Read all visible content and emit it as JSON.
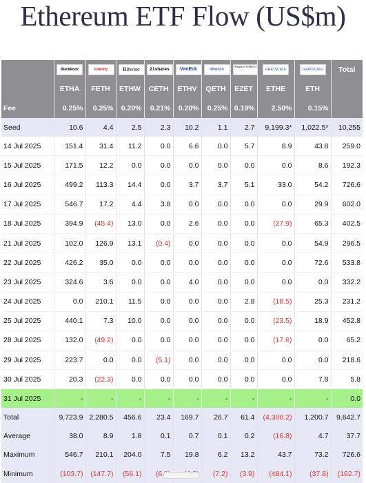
{
  "title": "Ethereum ETF Flow (US$m)",
  "header": {
    "total_label": "Total",
    "fee_label": "Fee",
    "funds": [
      {
        "logo": "BlackRock",
        "ticker": "ETHA",
        "fee": "0.25%"
      },
      {
        "logo": "Fidelity",
        "ticker": "FETH",
        "fee": "0.25%"
      },
      {
        "logo": "Bitwise",
        "ticker": "ETHW",
        "fee": "0.20%"
      },
      {
        "logo": "21shares",
        "ticker": "CETH",
        "fee": "0.21%"
      },
      {
        "logo": "VanEck",
        "ticker": "ETHV",
        "fee": "0.20%"
      },
      {
        "logo": "Invesco",
        "ticker": "QETH",
        "fee": "0.25%"
      },
      {
        "logo": "FRANKLIN TEMPLETON",
        "ticker": "EZET",
        "fee": "0.19%"
      },
      {
        "logo": "GRAYSCALE",
        "ticker": "ETHE",
        "fee": "2.50%"
      },
      {
        "logo": "GRAYSCALE",
        "ticker": "ETH",
        "fee": "0.15%"
      }
    ]
  },
  "rows": [
    {
      "label": "Seed",
      "values": [
        "10.6",
        "4.4",
        "2.5",
        "2.3",
        "10.2",
        "1.1",
        "2.7",
        "9,199.3*",
        "1,022.5*",
        "10,255"
      ]
    },
    {
      "label": "14 Jul 2025",
      "values": [
        "151.4",
        "31.4",
        "11.2",
        "0.0",
        "6.6",
        "0.0",
        "5.7",
        "8.9",
        "43.8",
        "259.0"
      ]
    },
    {
      "label": "15 Jul 2025",
      "values": [
        "171.5",
        "12.2",
        "0.0",
        "0.0",
        "0.0",
        "0.0",
        "0.0",
        "0.0",
        "8.6",
        "192.3"
      ]
    },
    {
      "label": "16 Jul 2025",
      "values": [
        "499.2",
        "113.3",
        "14.4",
        "0.0",
        "3.7",
        "3.7",
        "5.1",
        "33.0",
        "54.2",
        "726.6"
      ]
    },
    {
      "label": "17 Jul 2025",
      "values": [
        "546.7",
        "17.2",
        "4.4",
        "3.8",
        "0.0",
        "0.0",
        "0.0",
        "0.0",
        "29.9",
        "602.0"
      ]
    },
    {
      "label": "18 Jul 2025",
      "values": [
        "394.9",
        "(45.4)",
        "13.0",
        "0.0",
        "2.6",
        "0.0",
        "0.0",
        "(27.9)",
        "65.3",
        "402.5"
      ]
    },
    {
      "label": "21 Jul 2025",
      "values": [
        "102.0",
        "126.9",
        "13.1",
        "(0.4)",
        "0.0",
        "0.0",
        "0.0",
        "0.0",
        "54.9",
        "296.5"
      ]
    },
    {
      "label": "22 Jul 2025",
      "values": [
        "426.2",
        "35.0",
        "0.0",
        "0.0",
        "0.0",
        "0.0",
        "0.0",
        "0.0",
        "72.6",
        "533.8"
      ]
    },
    {
      "label": "23 Jul 2025",
      "values": [
        "324.6",
        "3.6",
        "0.0",
        "0.0",
        "4.0",
        "0.0",
        "0.0",
        "0.0",
        "0.0",
        "332.2"
      ]
    },
    {
      "label": "24 Jul 2025",
      "values": [
        "0.0",
        "210.1",
        "11.5",
        "0.0",
        "0.0",
        "0.0",
        "2.8",
        "(18.5)",
        "25.3",
        "231.2"
      ]
    },
    {
      "label": "25 Jul 2025",
      "values": [
        "440.1",
        "7.3",
        "10.0",
        "0.0",
        "0.0",
        "0.0",
        "0.0",
        "(23.5)",
        "18.9",
        "452.8"
      ]
    },
    {
      "label": "28 Jul 2025",
      "values": [
        "132.0",
        "(49.2)",
        "0.0",
        "0.0",
        "0.0",
        "0.0",
        "0.0",
        "(17.6)",
        "0.0",
        "65.2"
      ]
    },
    {
      "label": "29 Jul 2025",
      "values": [
        "223.7",
        "0.0",
        "0.0",
        "(5.1)",
        "0.0",
        "0.0",
        "0.0",
        "0.0",
        "0.0",
        "218.6"
      ]
    },
    {
      "label": "30 Jul 2025",
      "values": [
        "20.3",
        "(22.3)",
        "0.0",
        "0.0",
        "0.0",
        "0.0",
        "0.0",
        "0.0",
        "7.8",
        "5.8"
      ]
    },
    {
      "label": "31 Jul 2025",
      "values": [
        "-",
        "-",
        "-",
        "-",
        "-",
        "-",
        "-",
        "-",
        "-",
        "0.0"
      ]
    }
  ],
  "summary": [
    {
      "label": "Total",
      "values": [
        "9,723.9",
        "2,280.5",
        "456.6",
        "23.4",
        "169.7",
        "26.7",
        "61.4",
        "(4,300.2)",
        "1,200.7",
        "9,642.7"
      ]
    },
    {
      "label": "Average",
      "values": [
        "38.0",
        "8.9",
        "1.8",
        "0.1",
        "0.7",
        "0.1",
        "0.2",
        "(16.8)",
        "4.7",
        "37.7"
      ]
    },
    {
      "label": "Maximum",
      "values": [
        "546.7",
        "210.1",
        "204.0",
        "7.5",
        "19.8",
        "6.2",
        "13.2",
        "43.7",
        "73.2",
        "726.6"
      ]
    },
    {
      "label": "Minimum",
      "values": [
        "(103.7)",
        "(147.7)",
        "(56.1)",
        "(6.9)",
        "(4.8)",
        "(7.2)",
        "(3.9)",
        "(484.1)",
        "(37.8)",
        "(162.7)"
      ]
    }
  ],
  "colors": {
    "header": "#8e8e93",
    "highlight": "#e6e8f5",
    "pending": "#a6f08a",
    "negative": "#e0332a",
    "title": "#2e2e4a"
  }
}
